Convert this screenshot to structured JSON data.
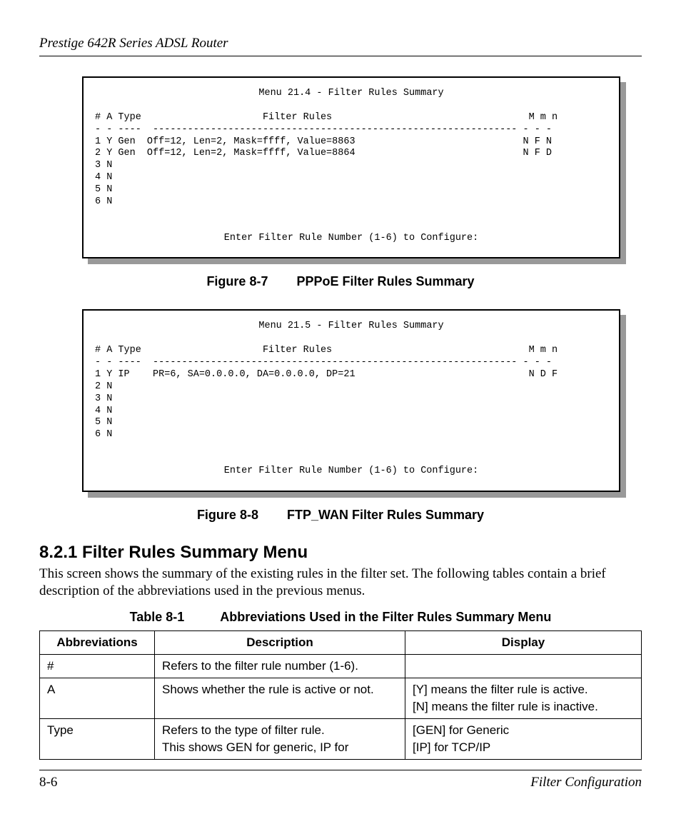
{
  "header": "Prestige 642R Series ADSL Router",
  "menu1": {
    "title": "Menu 21.4 - Filter Rules Summary",
    "head": "# A Type                     Filter Rules                                  M m n",
    "sep": "- - ----  --------------------------------------------------------------- - - -",
    "rows": [
      "1 Y Gen  Off=12, Len=2, Mask=ffff, Value=8863                             N F N",
      "2 Y Gen  Off=12, Len=2, Mask=ffff, Value=8864                             N F D",
      "3 N",
      "4 N",
      "5 N",
      "6 N"
    ],
    "prompt": "Enter Filter Rule Number (1-6) to Configure:"
  },
  "fig1": {
    "num": "Figure 8-7",
    "title": "PPPoE Filter Rules Summary"
  },
  "menu2": {
    "title": "Menu 21.5 - Filter Rules Summary",
    "head": "# A Type                     Filter Rules                                  M m n",
    "sep": "- - ----  --------------------------------------------------------------- - - -",
    "rows": [
      "1 Y IP    PR=6, SA=0.0.0.0, DA=0.0.0.0, DP=21                              N D F",
      "2 N",
      "3 N",
      "4 N",
      "5 N",
      "6 N"
    ],
    "prompt": "Enter Filter Rule Number (1-6) to Configure:"
  },
  "fig2": {
    "num": "Figure 8-8",
    "title": "FTP_WAN Filter Rules Summary"
  },
  "section": {
    "num_title": "8.2.1  Filter Rules Summary Menu",
    "para": "This screen shows the summary of the existing rules in the filter set.  The following tables contain a brief description of the abbreviations used in the previous menus."
  },
  "table": {
    "num": "Table 8-1",
    "title": "Abbreviations Used in the Filter Rules Summary Menu",
    "headers": {
      "c1": "Abbreviations",
      "c2": "Description",
      "c3": "Display"
    },
    "rows": [
      {
        "abbr": "#",
        "desc": [
          "Refers to the filter rule number (1-6)."
        ],
        "disp": [
          ""
        ]
      },
      {
        "abbr": "A",
        "desc": [
          "Shows whether the rule is active or not."
        ],
        "disp": [
          "[Y] means the filter rule is active.",
          "[N] means the filter rule is inactive."
        ]
      },
      {
        "abbr": "Type",
        "desc": [
          "Refers to the type of filter rule.",
          "This shows GEN for generic, IP for"
        ],
        "disp": [
          "[GEN] for Generic",
          "[IP] for TCP/IP"
        ]
      }
    ]
  },
  "footer": {
    "left": "8-6",
    "right": "Filter Configuration"
  }
}
